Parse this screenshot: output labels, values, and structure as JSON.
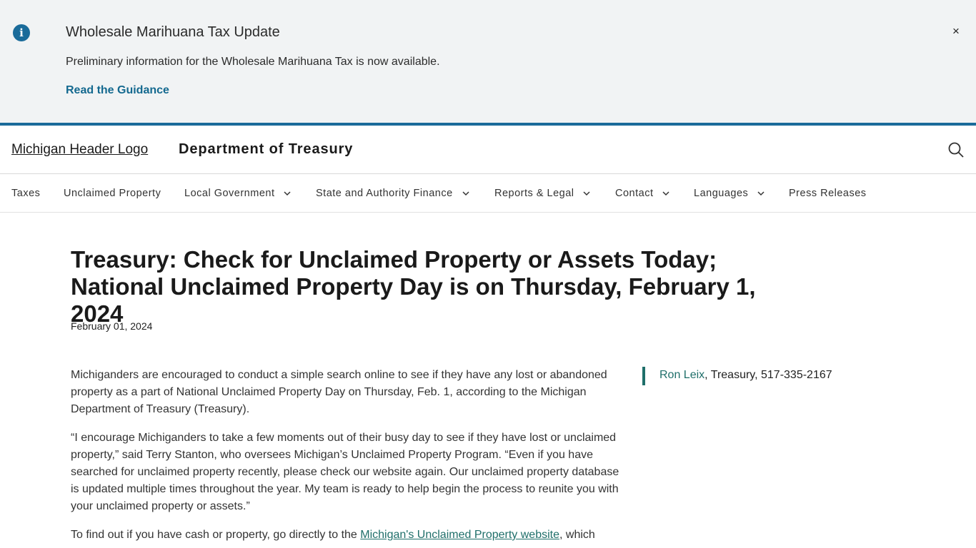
{
  "alert": {
    "icon": "info-icon",
    "title": "Wholesale Marihuana Tax Update",
    "text": "Preliminary information for the Wholesale Marihuana Tax is now available.",
    "link": "Read the Guidance",
    "close": "×",
    "accent": "#1a6b9a"
  },
  "header": {
    "logo_alt": "Michigan Header Logo",
    "title": "Department of Treasury",
    "search_icon": "search-icon"
  },
  "nav": {
    "items": [
      {
        "label": "Taxes",
        "dropdown": false
      },
      {
        "label": "Unclaimed Property",
        "dropdown": false
      },
      {
        "label": "Local Government",
        "dropdown": true
      },
      {
        "label": "State and Authority Finance",
        "dropdown": true
      },
      {
        "label": "Reports & Legal",
        "dropdown": true
      },
      {
        "label": "Contact",
        "dropdown": true
      },
      {
        "label": "Languages",
        "dropdown": true
      },
      {
        "label": "Press Releases",
        "dropdown": false
      }
    ]
  },
  "article": {
    "headline": "Treasury: Check for Unclaimed Property or Assets Today; National Unclaimed Property Day is on Thursday, February 1, 2024",
    "date": "February 01, 2024",
    "paragraphs": [
      "Michiganders are encouraged to conduct a simple search online to see if they have any lost or abandoned property as a part of National Unclaimed Property Day on Thursday, Feb. 1, according to the Michigan Department of Treasury (Treasury).",
      "“I encourage Michiganders to take a few moments out of their busy day to see if they have lost or unclaimed property,” said Terry Stanton, who oversees Michigan’s Unclaimed Property Program. “Even if you have searched for unclaimed property recently, please check our website again. Our unclaimed property database is updated multiple times throughout the year. My team is ready to help begin the process to reunite you with your unclaimed property or assets.”"
    ],
    "p3_before": "To find out if you have cash or property, go directly to the ",
    "p3_link": "Michigan's Unclaimed Property website",
    "p3_after": ", which",
    "link_color": "#1f6f6a"
  },
  "contact": {
    "name": "Ron Leix",
    "details": ", Treasury, 517-335-2167"
  }
}
